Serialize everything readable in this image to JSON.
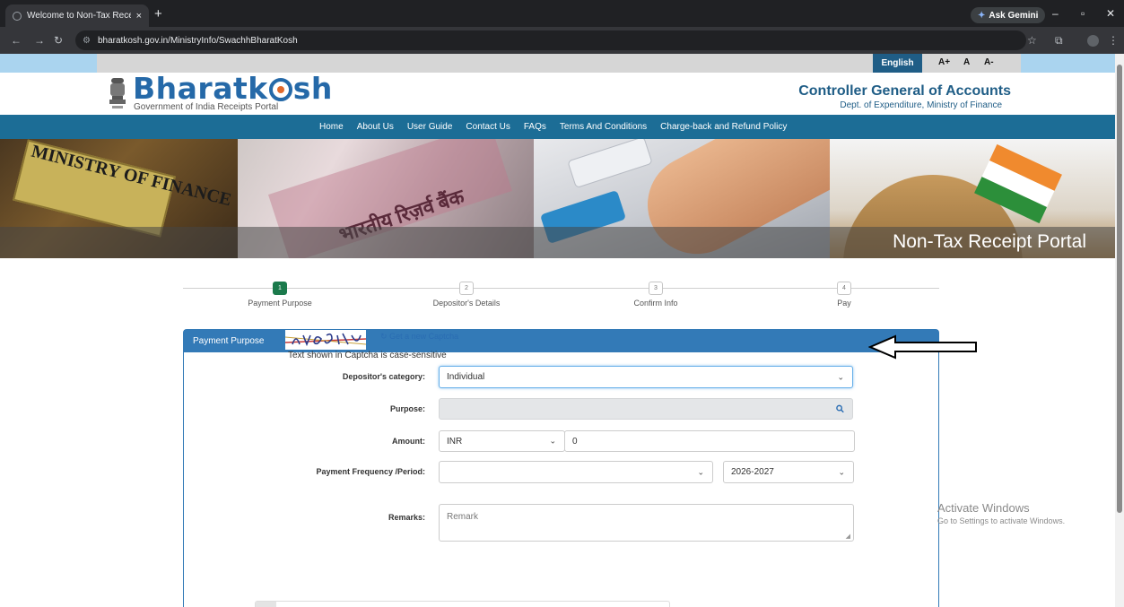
{
  "browser": {
    "tab_title": "Welcome to Non-Tax Receipt P",
    "tab_close": "×",
    "new_tab": "+",
    "gemini_label": "Ask Gemini",
    "url": "bharatkosh.gov.in/MinistryInfo/SwachhBharatKosh",
    "minimize": "–",
    "maximize": "▫",
    "close": "✕"
  },
  "topstrip": {
    "language": "English",
    "font_increase": "A+",
    "font_normal": "A",
    "font_decrease": "A-"
  },
  "header": {
    "logo_part1": "Bharatk",
    "logo_part2": "sh",
    "tagline": "Government of India Receipts Portal",
    "org_title": "Controller General of Accounts",
    "org_subtitle": "Dept. of Expenditure, Ministry of Finance"
  },
  "menu": {
    "items": [
      {
        "label": "Home"
      },
      {
        "label": "About Us"
      },
      {
        "label": "User Guide"
      },
      {
        "label": "Contact Us"
      },
      {
        "label": "FAQs"
      },
      {
        "label": "Terms And Conditions"
      },
      {
        "label": "Charge-back and Refund Policy"
      }
    ]
  },
  "banner": {
    "sign_text": "MINISTRY OF FINANCE",
    "note_text": "भारतीय रिज़र्व बैंक",
    "portal_title": "Non-Tax Receipt Portal"
  },
  "wizard": {
    "steps": [
      {
        "num": "1",
        "label": "Payment Purpose",
        "active": true
      },
      {
        "num": "2",
        "label": "Depositor's Details",
        "active": false
      },
      {
        "num": "3",
        "label": "Confirm Info",
        "active": false
      },
      {
        "num": "4",
        "label": "Pay",
        "active": false
      }
    ]
  },
  "form": {
    "panel_title": "Payment Purpose",
    "category_label": "Depositor's category:",
    "category_value": "Individual",
    "purpose_label": "Purpose:",
    "purpose_value": "",
    "amount_label": "Amount:",
    "currency_value": "INR",
    "amount_value": "0",
    "frequency_label": "Payment Frequency /Period:",
    "frequency_value": "",
    "year_value": "2026-2027",
    "remarks_label": "Remarks:",
    "remarks_placeholder": "Remark",
    "captcha_refresh": "Get a new Captcha",
    "captcha_note": "Text shown in Captcha is case-sensitive"
  },
  "os_watermark": {
    "line1": "Activate Windows",
    "line2": "Go to Settings to activate Windows."
  },
  "colors": {
    "menu_bar": "#1c6d96",
    "panel_header": "#337ab7",
    "active_step": "#1b7a4c",
    "logo_blue": "#2569a8"
  }
}
